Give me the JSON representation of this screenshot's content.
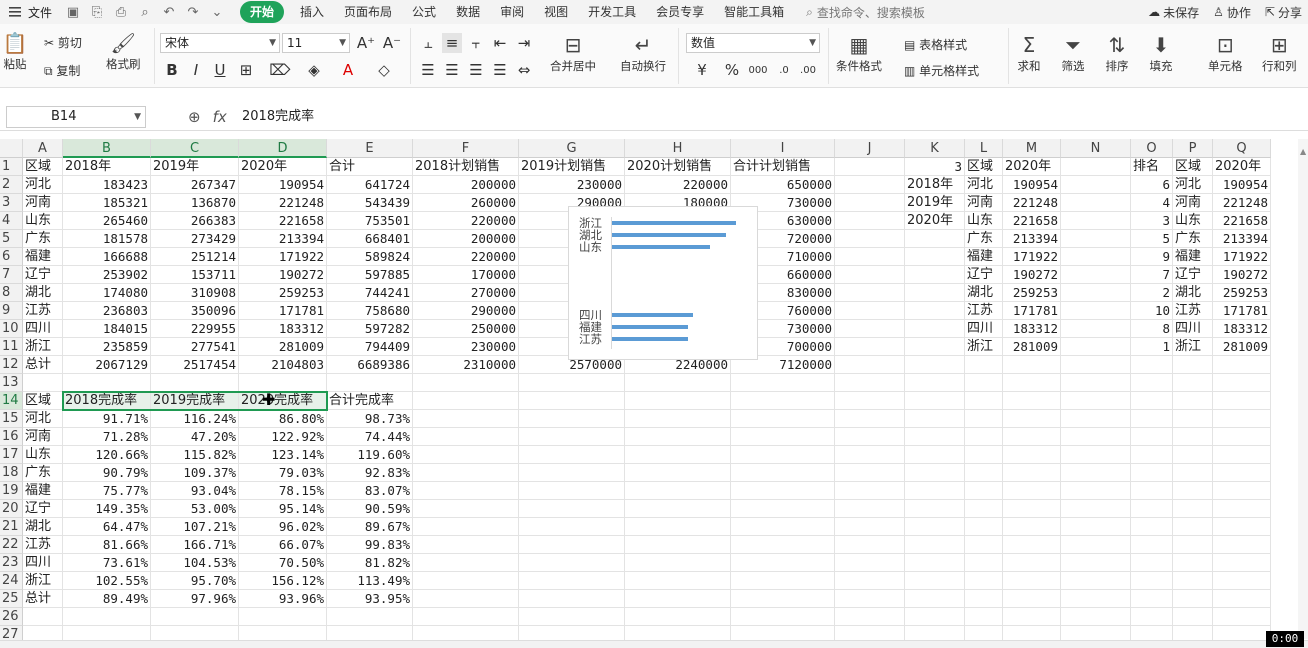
{
  "menu": {
    "file": "文件",
    "tabs": [
      "开始",
      "插入",
      "页面布局",
      "公式",
      "数据",
      "审阅",
      "视图",
      "开发工具",
      "会员专享",
      "智能工具箱"
    ],
    "active_tab": "开始",
    "search_placeholder": "查找命令、搜索模板",
    "unsaved": "未保存",
    "collab": "协作",
    "share": "分享"
  },
  "ribbon": {
    "paste": "粘贴",
    "cut": "剪切",
    "copy": "复制",
    "format_painter": "格式刷",
    "font_name": "宋体",
    "font_size": "11",
    "merge_center": "合并居中",
    "wrap": "自动换行",
    "number_format": "数值",
    "currency": "¥",
    "percent": "%",
    "cond_format": "条件格式",
    "table_style": "表格样式",
    "cell_style": "单元格样式",
    "sum": "求和",
    "filter": "筛选",
    "sort": "排序",
    "fill": "填充",
    "cell": "单元格",
    "row_col": "行和列"
  },
  "formula_bar": {
    "name_box": "B14",
    "fx": "fx",
    "content": "2018完成率"
  },
  "grid": {
    "columns": [
      "A",
      "B",
      "C",
      "D",
      "E",
      "F",
      "G",
      "H",
      "I",
      "J",
      "K",
      "L",
      "M",
      "N",
      "O",
      "P",
      "Q"
    ],
    "rows": [
      "1",
      "2",
      "3",
      "4",
      "5",
      "6",
      "7",
      "8",
      "9",
      "10",
      "11",
      "12",
      "13",
      "14",
      "15",
      "16",
      "17",
      "18",
      "19",
      "20",
      "21",
      "22",
      "23",
      "24",
      "25",
      "26",
      "27"
    ],
    "selected_columns": [
      "B",
      "C",
      "D"
    ],
    "selected_row": "14",
    "table1": {
      "header": [
        "区域",
        "2018年",
        "2019年",
        "2020年",
        "合计",
        "2018计划销售",
        "2019计划销售",
        "2020计划销售",
        "合计计划销售"
      ],
      "rows": [
        [
          "河北",
          "183423",
          "267347",
          "190954",
          "641724",
          "200000",
          "230000",
          "220000",
          "650000"
        ],
        [
          "河南",
          "185321",
          "136870",
          "221248",
          "543439",
          "260000",
          "290000",
          "180000",
          "730000"
        ],
        [
          "山东",
          "265460",
          "266383",
          "221658",
          "753501",
          "220000",
          "",
          "",
          "630000"
        ],
        [
          "广东",
          "181578",
          "273429",
          "213394",
          "668401",
          "200000",
          "",
          "",
          "720000"
        ],
        [
          "福建",
          "166688",
          "251214",
          "171922",
          "589824",
          "220000",
          "",
          "",
          "710000"
        ],
        [
          "辽宁",
          "253902",
          "153711",
          "190272",
          "597885",
          "170000",
          "",
          "",
          "660000"
        ],
        [
          "湖北",
          "174080",
          "310908",
          "259253",
          "744241",
          "270000",
          "",
          "",
          "830000"
        ],
        [
          "江苏",
          "236803",
          "350096",
          "171781",
          "758680",
          "290000",
          "",
          "",
          "760000"
        ],
        [
          "四川",
          "184015",
          "229955",
          "183312",
          "597282",
          "250000",
          "",
          "",
          "730000"
        ],
        [
          "浙江",
          "235859",
          "277541",
          "281009",
          "794409",
          "230000",
          "",
          "",
          "700000"
        ],
        [
          "总计",
          "2067129",
          "2517454",
          "2104803",
          "6689386",
          "2310000",
          "2570000",
          "2240000",
          "7120000"
        ]
      ]
    },
    "table2": {
      "header": [
        "区域",
        "2018完成率",
        "2019完成率",
        "2020完成率",
        "合计完成率"
      ],
      "rows": [
        [
          "河北",
          "91.71%",
          "116.24%",
          "86.80%",
          "98.73%"
        ],
        [
          "河南",
          "71.28%",
          "47.20%",
          "122.92%",
          "74.44%"
        ],
        [
          "山东",
          "120.66%",
          "115.82%",
          "123.14%",
          "119.60%"
        ],
        [
          "广东",
          "90.79%",
          "109.37%",
          "79.03%",
          "92.83%"
        ],
        [
          "福建",
          "75.77%",
          "93.04%",
          "78.15%",
          "83.07%"
        ],
        [
          "辽宁",
          "149.35%",
          "53.00%",
          "95.14%",
          "90.59%"
        ],
        [
          "湖北",
          "64.47%",
          "107.21%",
          "96.02%",
          "89.67%"
        ],
        [
          "江苏",
          "81.66%",
          "166.71%",
          "66.07%",
          "99.83%"
        ],
        [
          "四川",
          "73.61%",
          "104.53%",
          "70.50%",
          "81.82%"
        ],
        [
          "浙江",
          "102.55%",
          "95.70%",
          "156.12%",
          "113.49%"
        ],
        [
          "总计",
          "89.49%",
          "97.96%",
          "93.96%",
          "93.95%"
        ]
      ]
    },
    "side_k": {
      "k1": "3",
      "years": [
        "2018年",
        "2019年",
        "2020年"
      ]
    },
    "table3": {
      "header": [
        "区域",
        "2020年"
      ],
      "rows": [
        [
          "河北",
          "190954"
        ],
        [
          "河南",
          "221248"
        ],
        [
          "山东",
          "221658"
        ],
        [
          "广东",
          "213394"
        ],
        [
          "福建",
          "171922"
        ],
        [
          "辽宁",
          "190272"
        ],
        [
          "湖北",
          "259253"
        ],
        [
          "江苏",
          "171781"
        ],
        [
          "四川",
          "183312"
        ],
        [
          "浙江",
          "281009"
        ]
      ]
    },
    "table4": {
      "header": [
        "排名",
        "区域",
        "2020年"
      ],
      "rows": [
        [
          "6",
          "河北",
          "190954"
        ],
        [
          "4",
          "河南",
          "221248"
        ],
        [
          "3",
          "山东",
          "221658"
        ],
        [
          "5",
          "广东",
          "213394"
        ],
        [
          "9",
          "福建",
          "171922"
        ],
        [
          "7",
          "辽宁",
          "190272"
        ],
        [
          "2",
          "湖北",
          "259253"
        ],
        [
          "10",
          "江苏",
          "171781"
        ],
        [
          "8",
          "四川",
          "183312"
        ],
        [
          "1",
          "浙江",
          "281009"
        ]
      ]
    }
  },
  "chart_data": {
    "type": "bar",
    "orientation": "horizontal",
    "categories": [
      "浙江",
      "湖北",
      "山东",
      "四川",
      "福建",
      "江苏"
    ],
    "values": [
      281009,
      259253,
      221658,
      183312,
      171922,
      171781
    ],
    "gap_between": [
      "山东",
      "四川"
    ]
  },
  "timer": "0:00"
}
